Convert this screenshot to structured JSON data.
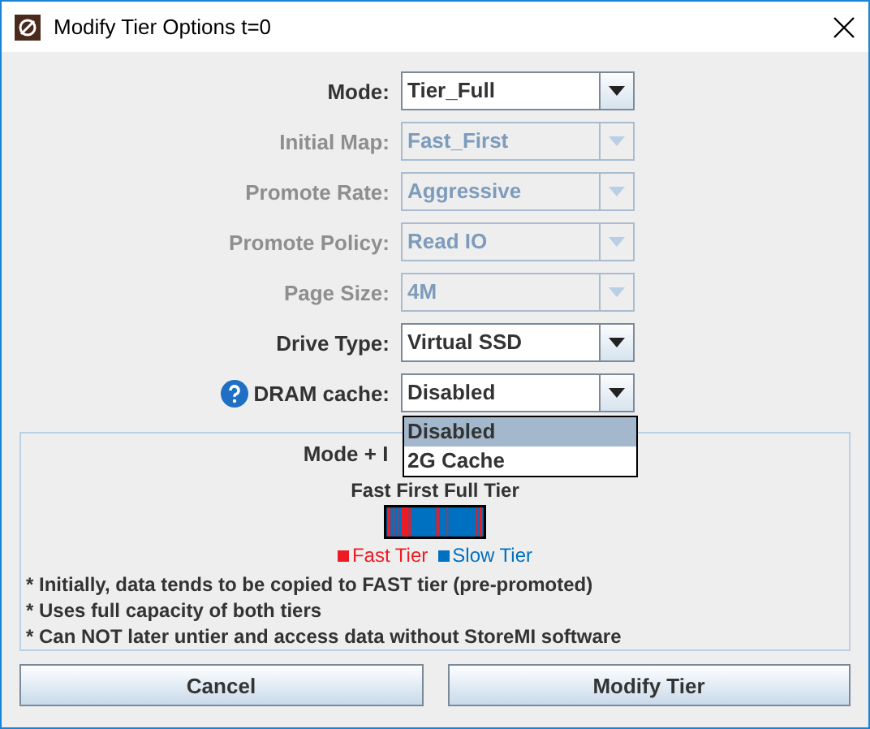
{
  "window": {
    "title": "Modify Tier Options t=0"
  },
  "fields": [
    {
      "label": "Mode:",
      "value": "Tier_Full",
      "disabled": false,
      "help": false
    },
    {
      "label": "Initial Map:",
      "value": "Fast_First",
      "disabled": true,
      "help": false
    },
    {
      "label": "Promote Rate:",
      "value": "Aggressive",
      "disabled": true,
      "help": false
    },
    {
      "label": "Promote Policy:",
      "value": "Read IO",
      "disabled": true,
      "help": false
    },
    {
      "label": "Page Size:",
      "value": "4M",
      "disabled": true,
      "help": false
    },
    {
      "label": "Drive Type:",
      "value": "Virtual SSD",
      "disabled": false,
      "help": false
    },
    {
      "label": "DRAM cache:",
      "value": "Disabled",
      "disabled": false,
      "help": true
    }
  ],
  "dropdown": {
    "options": [
      {
        "label": "Disabled",
        "selected": true
      },
      {
        "label": "2G Cache",
        "selected": false
      }
    ]
  },
  "preview": {
    "title": "Mode + I",
    "subtitle": "Fast First Full Tier",
    "legend": [
      {
        "label": "Fast Tier",
        "color": "#ed1c24"
      },
      {
        "label": "Slow Tier",
        "color": "#0070c0"
      }
    ],
    "notes": [
      "* Initially, data tends to be copied to FAST tier (pre-promoted)",
      "* Uses full capacity of both tiers",
      "* Can NOT later untier and access data without StoreMI software"
    ]
  },
  "buttons": [
    "Cancel",
    "Modify Tier"
  ]
}
